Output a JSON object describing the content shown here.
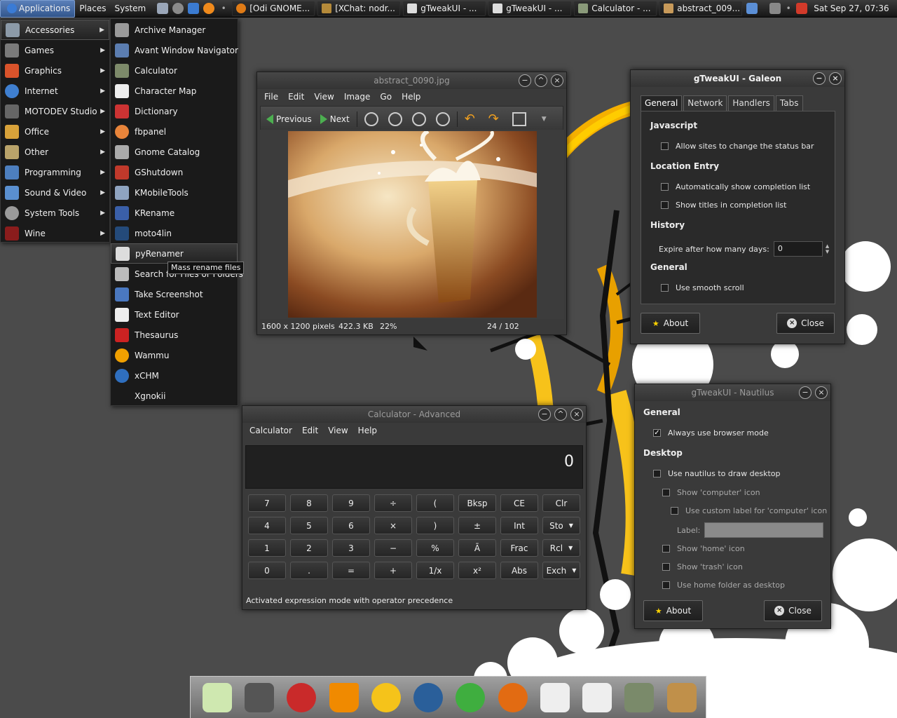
{
  "top_panel": {
    "menus": [
      "Applications",
      "Places",
      "System"
    ],
    "tasks": [
      "[Odi GNOME...",
      "[XChat: nodr...",
      "gTweakUI - ...",
      "gTweakUI - ...",
      "Calculator - ...",
      "abstract_009..."
    ],
    "clock": "Sat Sep 27, 07:36"
  },
  "applications_menu": {
    "items": [
      "Accessories",
      "Games",
      "Graphics",
      "Internet",
      "MOTODEV Studio",
      "Office",
      "Other",
      "Programming",
      "Sound & Video",
      "System Tools",
      "Wine"
    ]
  },
  "accessories_menu": {
    "items": [
      "Archive Manager",
      "Avant Window Navigator",
      "Calculator",
      "Character Map",
      "Dictionary",
      "fbpanel",
      "Gnome Catalog",
      "GShutdown",
      "KMobileTools",
      "KRename",
      "moto4lin",
      "pyRenamer",
      "Search for Files or Folders",
      "Take Screenshot",
      "Text Editor",
      "Thesaurus",
      "Wammu",
      "xCHM",
      "Xgnokii"
    ],
    "tooltip": "Mass rename files"
  },
  "image_viewer": {
    "title": "abstract_0090.jpg",
    "menus": [
      "File",
      "Edit",
      "View",
      "Image",
      "Go",
      "Help"
    ],
    "previous_label": "Previous",
    "next_label": "Next",
    "status_dims": "1600 x 1200 pixels",
    "status_size": "422.3 KB",
    "status_zoom": "22%",
    "status_count": "24 / 102"
  },
  "calculator": {
    "title": "Calculator - Advanced",
    "menus": [
      "Calculator",
      "Edit",
      "View",
      "Help"
    ],
    "display": "0",
    "buttons": [
      [
        "7",
        "8",
        "9",
        "÷",
        "(",
        "Bksp",
        "CE",
        "Clr"
      ],
      [
        "4",
        "5",
        "6",
        "×",
        ")",
        "±",
        "Int",
        "Sto"
      ],
      [
        "1",
        "2",
        "3",
        "−",
        "%",
        "Ā",
        "Frac",
        "Rcl"
      ],
      [
        "0",
        ".",
        "=",
        "+",
        "1/x",
        "x²",
        "Abs",
        "Exch"
      ]
    ],
    "status": "Activated expression mode with operator precedence"
  },
  "galeon": {
    "title": "gTweakUI - Galeon",
    "tabs": [
      "General",
      "Network",
      "Handlers",
      "Tabs"
    ],
    "sections": {
      "javascript": "Javascript",
      "location": "Location Entry",
      "history": "History",
      "general": "General"
    },
    "options": {
      "status_bar": "Allow sites to change the status bar",
      "auto_completion": "Automatically show completion list",
      "show_titles": "Show titles in completion list",
      "expire_label": "Expire after how many days:",
      "expire_value": "0",
      "smooth_scroll": "Use smooth scroll"
    },
    "about_label": "About",
    "close_label": "Close"
  },
  "nautilus": {
    "title": "gTweakUI - Nautilus",
    "sections": {
      "general": "General",
      "desktop": "Desktop"
    },
    "options": {
      "browser_mode": "Always use browser mode",
      "draw_desktop": "Use nautilus to draw desktop",
      "show_computer": "Show 'computer' icon",
      "custom_label": "Use custom label for 'computer' icon",
      "label_label": "Label:",
      "show_home": "Show 'home' icon",
      "show_trash": "Show 'trash' icon",
      "home_desktop": "Use home folder as desktop"
    },
    "about_label": "About",
    "close_label": "Close"
  },
  "dock": {
    "icons": [
      "recycle-icon",
      "clapper-icon",
      "cd-icon",
      "vlc-icon",
      "smiley-icon",
      "drop-icon",
      "play-icon",
      "firefox-icon",
      "gtweakui-icon",
      "gtweakui-icon",
      "calculator-icon",
      "image-icon"
    ]
  },
  "colors": {
    "accent_yellow": "#f7c21a",
    "selection_blue": "#4a6fa5"
  }
}
